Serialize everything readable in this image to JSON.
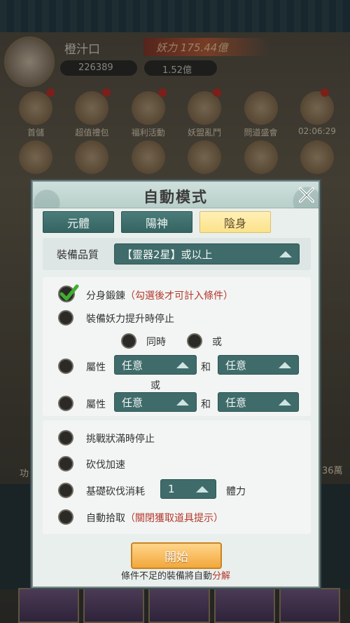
{
  "background": {
    "player_name": "橙汁口",
    "power_label": "妖力",
    "power_value": "175.44億",
    "currency1": "226389",
    "currency2": "1.52億",
    "icons_row1": [
      "首儲",
      "超值禮包",
      "福利活動",
      "妖盟亂鬥",
      "問道盛會",
      "02:06:29"
    ],
    "icons_row2": [
      "",
      "",
      "",
      "",
      "",
      ""
    ],
    "side_right": "36萬",
    "side_left": "功"
  },
  "dialog": {
    "title": "自動模式",
    "tabs": [
      {
        "label": "元體",
        "active": false
      },
      {
        "label": "陽神",
        "active": false
      },
      {
        "label": "陰身",
        "active": true
      }
    ],
    "quality_label": "裝備品質",
    "quality_value": "【靈器2星】或以上",
    "options": {
      "clone_forge": {
        "label": "分身鍛錬",
        "note": "（勾選後才可計入條件）",
        "checked": true
      },
      "stop_on_power_up": {
        "label": "裝備妖力提升時停止",
        "checked": false
      },
      "simultaneous": "同時",
      "or": "或",
      "attr_label": "屬性",
      "and": "和",
      "attr_row1": [
        "任意",
        "任意"
      ],
      "middle_or": "或",
      "attr_row2": [
        "任意",
        "任意"
      ]
    },
    "options2": {
      "stop_challenge_full": "挑戰狀滿時停止",
      "chop_speedup": "砍伐加速",
      "base_chop_cost": "基礎砍伐消耗",
      "base_chop_value": "1",
      "stamina": "體力",
      "auto_pickup": "自動拾取",
      "auto_pickup_note": "（關閉獲取道具提示）"
    },
    "start_label": "開始",
    "footnote_prefix": "條件不足的裝備將自動",
    "footnote_highlight": "分解"
  },
  "colors": {
    "tab_active": "#fbe28a",
    "tab_inactive": "#3f6c6a",
    "select_bg": "#3f6c6a",
    "note_red": "#b4372c",
    "start_button": "#f2a83c",
    "check_green": "#3fae2f"
  }
}
